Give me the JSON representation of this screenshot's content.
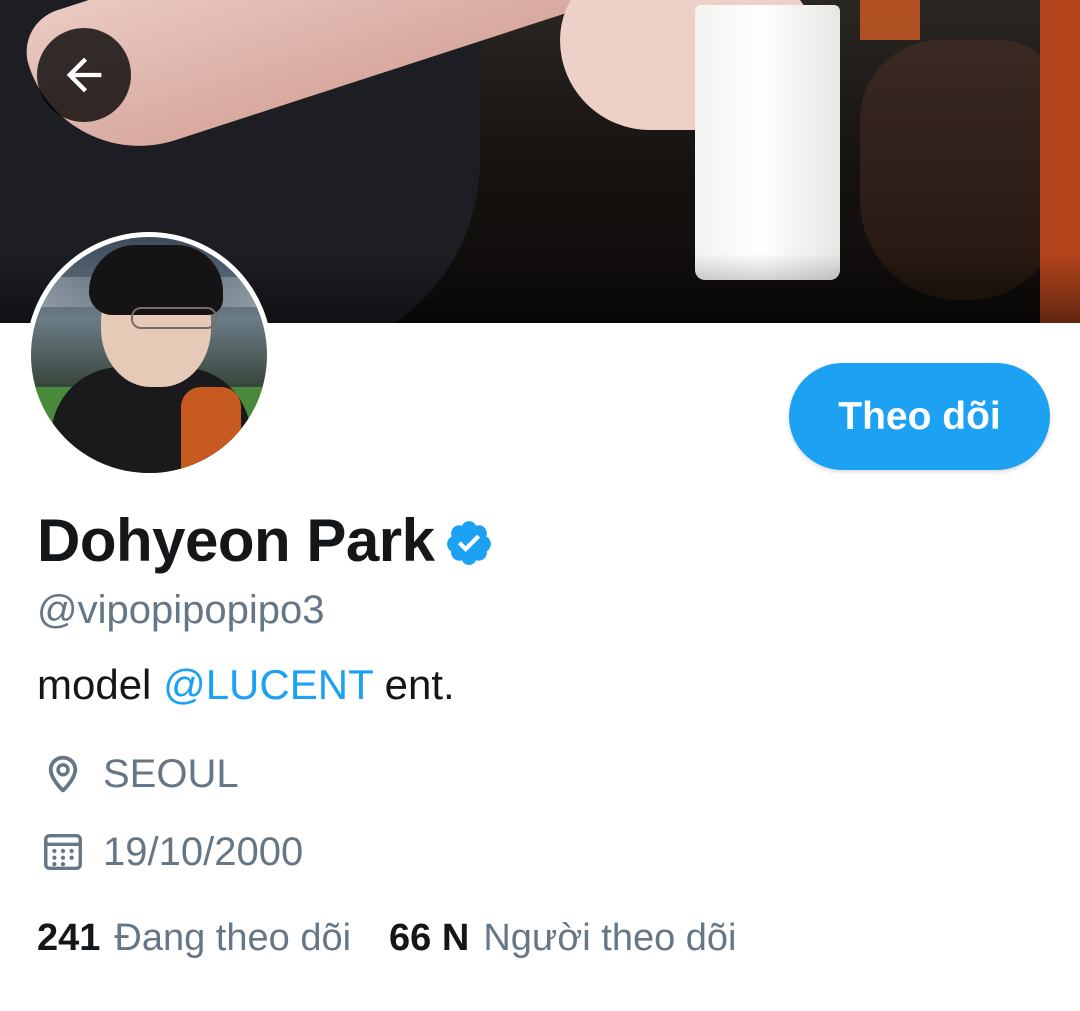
{
  "header": {
    "back_icon": "arrow-left-icon"
  },
  "profile": {
    "display_name": "Dohyeon Park",
    "verified_icon": "verified-badge-icon",
    "handle": "@vipopipopipo3",
    "bio": {
      "prefix": "model ",
      "mention": "@LUCENT",
      "suffix": " ent."
    },
    "location": "SEOUL",
    "birth_date": "19/10/2000",
    "following_count": "241",
    "following_label": "Đang theo dõi",
    "followers_count": "66 N",
    "followers_label": "Người theo dõi"
  },
  "actions": {
    "follow_label": "Theo dõi"
  },
  "colors": {
    "accent": "#1da1f2",
    "secondary_text": "#657786",
    "primary_text": "#14171a"
  }
}
